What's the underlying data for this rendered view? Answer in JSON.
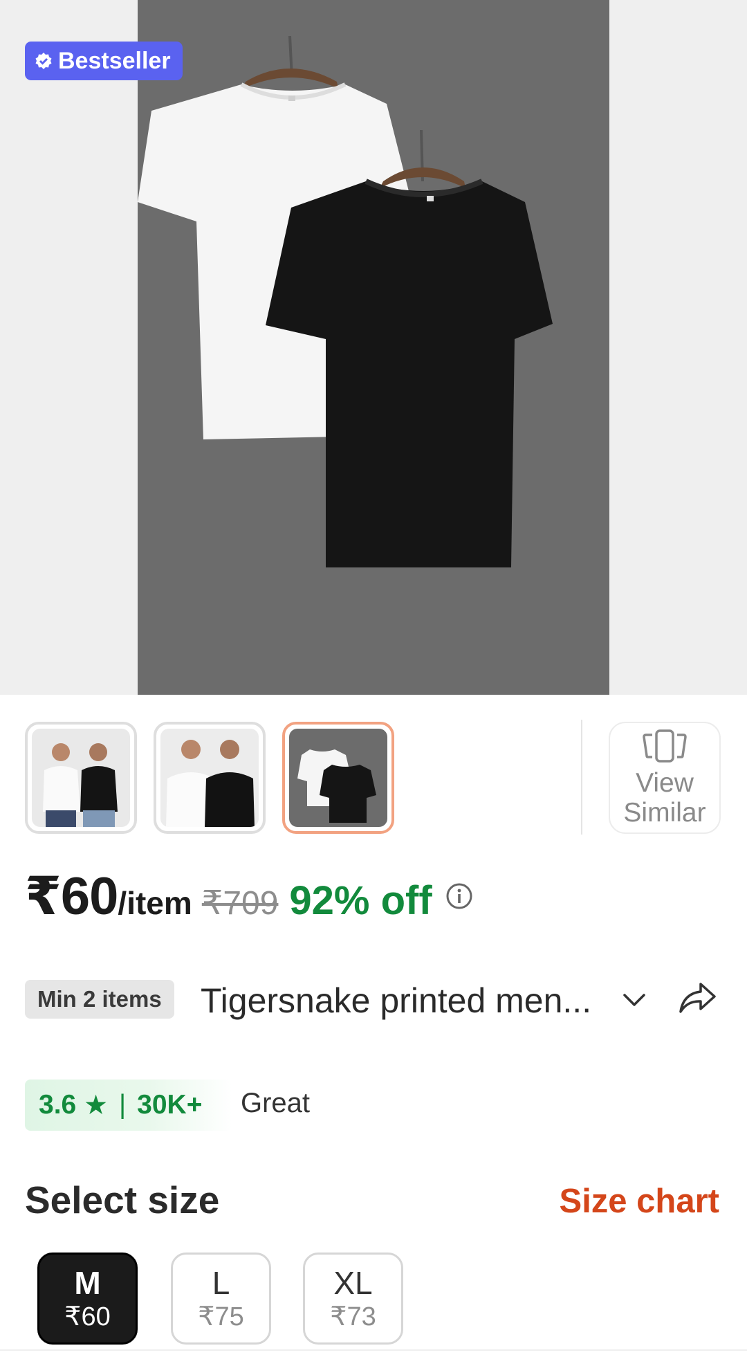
{
  "hero": {
    "badge_label": "Bestseller",
    "badge_icon": "verified-check-icon",
    "badge_color": "#5a62f0"
  },
  "thumbnails": {
    "items": [
      {
        "alt": "two men wearing white and black t-shirts"
      },
      {
        "alt": "two men wearing white and black t-shirts front"
      },
      {
        "alt": "white and black t-shirts on hangers",
        "selected": true
      }
    ],
    "view_similar_line1": "View",
    "view_similar_line2": "Similar",
    "view_similar_icon": "stack-cards-icon"
  },
  "price": {
    "current": "₹60",
    "unit": "/item",
    "mrp": "₹709",
    "discount": "92% off",
    "discount_color": "#128a3c"
  },
  "product": {
    "min_items": "Min 2 items",
    "title": "Tigersnake printed men...",
    "expand_icon": "chevron-down-icon",
    "share_icon": "share-arrow-icon"
  },
  "rating": {
    "score": "3.6",
    "star": "★",
    "separator": "|",
    "count": "30K+",
    "label": "Great"
  },
  "size": {
    "heading": "Select size",
    "chart_link": "Size chart",
    "chart_color": "#d4461a",
    "options": [
      {
        "size": "M",
        "price": "₹60",
        "selected": true
      },
      {
        "size": "L",
        "price": "₹75",
        "selected": false
      },
      {
        "size": "XL",
        "price": "₹73",
        "selected": false
      }
    ]
  }
}
